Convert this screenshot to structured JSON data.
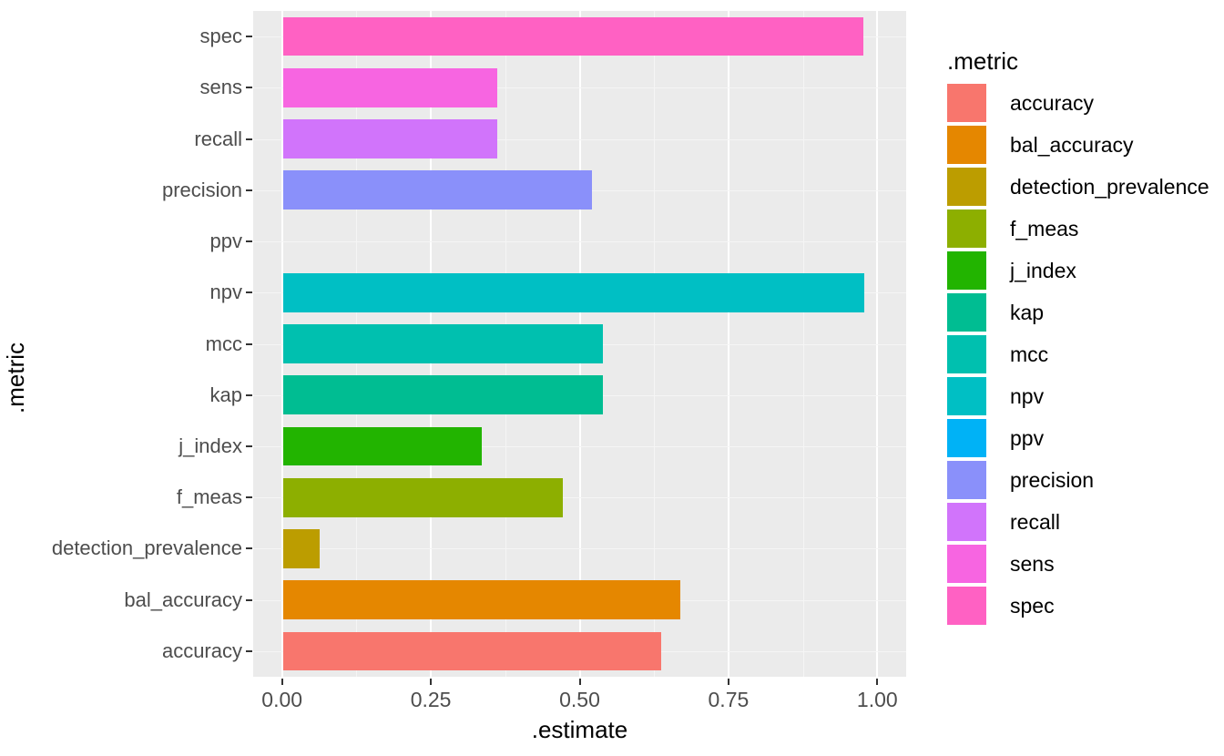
{
  "chart_data": {
    "type": "bar",
    "orientation": "horizontal",
    "title": "",
    "xlabel": ".estimate",
    "ylabel": ".metric",
    "xlim": [
      -0.0485,
      1.0485
    ],
    "x_ticks": [
      "0.00",
      "0.25",
      "0.50",
      "0.75",
      "1.00"
    ],
    "x_tick_values": [
      0.0,
      0.25,
      0.5,
      0.75,
      1.0
    ],
    "grid": true,
    "legend_position": "right",
    "legend_title": ".metric",
    "categories": [
      "spec",
      "sens",
      "recall",
      "precision",
      "ppv",
      "npv",
      "mcc",
      "kap",
      "j_index",
      "f_meas",
      "detection_prevalence",
      "bal_accuracy",
      "accuracy"
    ],
    "values": [
      0.974,
      0.36,
      0.36,
      0.519,
      0.0,
      0.976,
      0.537,
      0.537,
      0.333,
      0.469,
      0.061,
      0.667,
      0.635
    ],
    "colors": [
      "#FF61C3",
      "#F765E1",
      "#D174FB",
      "#8A90FA",
      "#00B2F6",
      "#00BFC4",
      "#00C0AF",
      "#00BD92",
      "#22B400",
      "#8DAF00",
      "#BC9D00",
      "#E58700",
      "#F8766D"
    ]
  },
  "legend": {
    "title": ".metric",
    "items": [
      {
        "label": "accuracy",
        "color": "#F8766D"
      },
      {
        "label": "bal_accuracy",
        "color": "#E58700"
      },
      {
        "label": "detection_prevalence",
        "color": "#BC9D00"
      },
      {
        "label": "f_meas",
        "color": "#8DAF00"
      },
      {
        "label": "j_index",
        "color": "#22B400"
      },
      {
        "label": "kap",
        "color": "#00BD92"
      },
      {
        "label": "mcc",
        "color": "#00C0AF"
      },
      {
        "label": "npv",
        "color": "#00BFC4"
      },
      {
        "label": "ppv",
        "color": "#00B2F6"
      },
      {
        "label": "precision",
        "color": "#8A90FA"
      },
      {
        "label": "recall",
        "color": "#D174FB"
      },
      {
        "label": "sens",
        "color": "#F765E1"
      },
      {
        "label": "spec",
        "color": "#FF61C3"
      }
    ]
  },
  "theme": {
    "panel_background": "#EBEBEB",
    "major_grid": "#FFFFFF",
    "minor_grid": "#F5F5F5",
    "axis_text": "#4D4D4D",
    "axis_title": "#000000"
  }
}
